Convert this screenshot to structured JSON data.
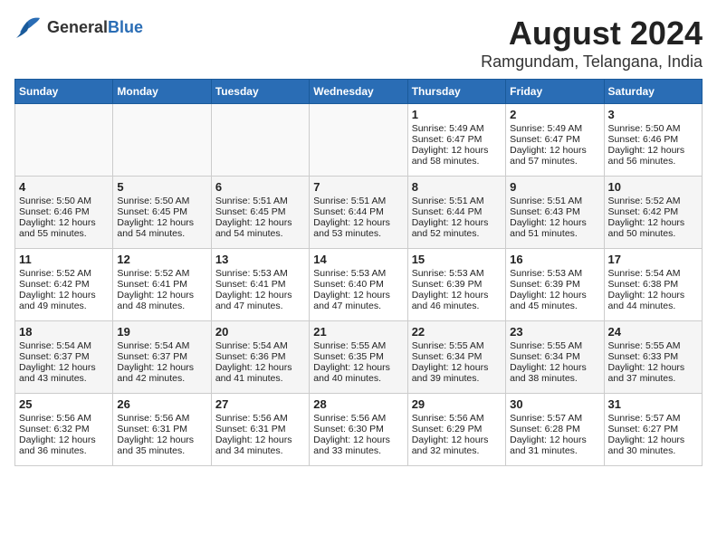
{
  "logo": {
    "general": "General",
    "blue": "Blue"
  },
  "header": {
    "month": "August 2024",
    "location": "Ramgundam, Telangana, India"
  },
  "weekdays": [
    "Sunday",
    "Monday",
    "Tuesday",
    "Wednesday",
    "Thursday",
    "Friday",
    "Saturday"
  ],
  "weeks": [
    [
      {
        "day": "",
        "sunrise": "",
        "sunset": "",
        "daylight": ""
      },
      {
        "day": "",
        "sunrise": "",
        "sunset": "",
        "daylight": ""
      },
      {
        "day": "",
        "sunrise": "",
        "sunset": "",
        "daylight": ""
      },
      {
        "day": "",
        "sunrise": "",
        "sunset": "",
        "daylight": ""
      },
      {
        "day": "1",
        "sunrise": "Sunrise: 5:49 AM",
        "sunset": "Sunset: 6:47 PM",
        "daylight": "Daylight: 12 hours and 58 minutes."
      },
      {
        "day": "2",
        "sunrise": "Sunrise: 5:49 AM",
        "sunset": "Sunset: 6:47 PM",
        "daylight": "Daylight: 12 hours and 57 minutes."
      },
      {
        "day": "3",
        "sunrise": "Sunrise: 5:50 AM",
        "sunset": "Sunset: 6:46 PM",
        "daylight": "Daylight: 12 hours and 56 minutes."
      }
    ],
    [
      {
        "day": "4",
        "sunrise": "Sunrise: 5:50 AM",
        "sunset": "Sunset: 6:46 PM",
        "daylight": "Daylight: 12 hours and 55 minutes."
      },
      {
        "day": "5",
        "sunrise": "Sunrise: 5:50 AM",
        "sunset": "Sunset: 6:45 PM",
        "daylight": "Daylight: 12 hours and 54 minutes."
      },
      {
        "day": "6",
        "sunrise": "Sunrise: 5:51 AM",
        "sunset": "Sunset: 6:45 PM",
        "daylight": "Daylight: 12 hours and 54 minutes."
      },
      {
        "day": "7",
        "sunrise": "Sunrise: 5:51 AM",
        "sunset": "Sunset: 6:44 PM",
        "daylight": "Daylight: 12 hours and 53 minutes."
      },
      {
        "day": "8",
        "sunrise": "Sunrise: 5:51 AM",
        "sunset": "Sunset: 6:44 PM",
        "daylight": "Daylight: 12 hours and 52 minutes."
      },
      {
        "day": "9",
        "sunrise": "Sunrise: 5:51 AM",
        "sunset": "Sunset: 6:43 PM",
        "daylight": "Daylight: 12 hours and 51 minutes."
      },
      {
        "day": "10",
        "sunrise": "Sunrise: 5:52 AM",
        "sunset": "Sunset: 6:42 PM",
        "daylight": "Daylight: 12 hours and 50 minutes."
      }
    ],
    [
      {
        "day": "11",
        "sunrise": "Sunrise: 5:52 AM",
        "sunset": "Sunset: 6:42 PM",
        "daylight": "Daylight: 12 hours and 49 minutes."
      },
      {
        "day": "12",
        "sunrise": "Sunrise: 5:52 AM",
        "sunset": "Sunset: 6:41 PM",
        "daylight": "Daylight: 12 hours and 48 minutes."
      },
      {
        "day": "13",
        "sunrise": "Sunrise: 5:53 AM",
        "sunset": "Sunset: 6:41 PM",
        "daylight": "Daylight: 12 hours and 47 minutes."
      },
      {
        "day": "14",
        "sunrise": "Sunrise: 5:53 AM",
        "sunset": "Sunset: 6:40 PM",
        "daylight": "Daylight: 12 hours and 47 minutes."
      },
      {
        "day": "15",
        "sunrise": "Sunrise: 5:53 AM",
        "sunset": "Sunset: 6:39 PM",
        "daylight": "Daylight: 12 hours and 46 minutes."
      },
      {
        "day": "16",
        "sunrise": "Sunrise: 5:53 AM",
        "sunset": "Sunset: 6:39 PM",
        "daylight": "Daylight: 12 hours and 45 minutes."
      },
      {
        "day": "17",
        "sunrise": "Sunrise: 5:54 AM",
        "sunset": "Sunset: 6:38 PM",
        "daylight": "Daylight: 12 hours and 44 minutes."
      }
    ],
    [
      {
        "day": "18",
        "sunrise": "Sunrise: 5:54 AM",
        "sunset": "Sunset: 6:37 PM",
        "daylight": "Daylight: 12 hours and 43 minutes."
      },
      {
        "day": "19",
        "sunrise": "Sunrise: 5:54 AM",
        "sunset": "Sunset: 6:37 PM",
        "daylight": "Daylight: 12 hours and 42 minutes."
      },
      {
        "day": "20",
        "sunrise": "Sunrise: 5:54 AM",
        "sunset": "Sunset: 6:36 PM",
        "daylight": "Daylight: 12 hours and 41 minutes."
      },
      {
        "day": "21",
        "sunrise": "Sunrise: 5:55 AM",
        "sunset": "Sunset: 6:35 PM",
        "daylight": "Daylight: 12 hours and 40 minutes."
      },
      {
        "day": "22",
        "sunrise": "Sunrise: 5:55 AM",
        "sunset": "Sunset: 6:34 PM",
        "daylight": "Daylight: 12 hours and 39 minutes."
      },
      {
        "day": "23",
        "sunrise": "Sunrise: 5:55 AM",
        "sunset": "Sunset: 6:34 PM",
        "daylight": "Daylight: 12 hours and 38 minutes."
      },
      {
        "day": "24",
        "sunrise": "Sunrise: 5:55 AM",
        "sunset": "Sunset: 6:33 PM",
        "daylight": "Daylight: 12 hours and 37 minutes."
      }
    ],
    [
      {
        "day": "25",
        "sunrise": "Sunrise: 5:56 AM",
        "sunset": "Sunset: 6:32 PM",
        "daylight": "Daylight: 12 hours and 36 minutes."
      },
      {
        "day": "26",
        "sunrise": "Sunrise: 5:56 AM",
        "sunset": "Sunset: 6:31 PM",
        "daylight": "Daylight: 12 hours and 35 minutes."
      },
      {
        "day": "27",
        "sunrise": "Sunrise: 5:56 AM",
        "sunset": "Sunset: 6:31 PM",
        "daylight": "Daylight: 12 hours and 34 minutes."
      },
      {
        "day": "28",
        "sunrise": "Sunrise: 5:56 AM",
        "sunset": "Sunset: 6:30 PM",
        "daylight": "Daylight: 12 hours and 33 minutes."
      },
      {
        "day": "29",
        "sunrise": "Sunrise: 5:56 AM",
        "sunset": "Sunset: 6:29 PM",
        "daylight": "Daylight: 12 hours and 32 minutes."
      },
      {
        "day": "30",
        "sunrise": "Sunrise: 5:57 AM",
        "sunset": "Sunset: 6:28 PM",
        "daylight": "Daylight: 12 hours and 31 minutes."
      },
      {
        "day": "31",
        "sunrise": "Sunrise: 5:57 AM",
        "sunset": "Sunset: 6:27 PM",
        "daylight": "Daylight: 12 hours and 30 minutes."
      }
    ]
  ]
}
